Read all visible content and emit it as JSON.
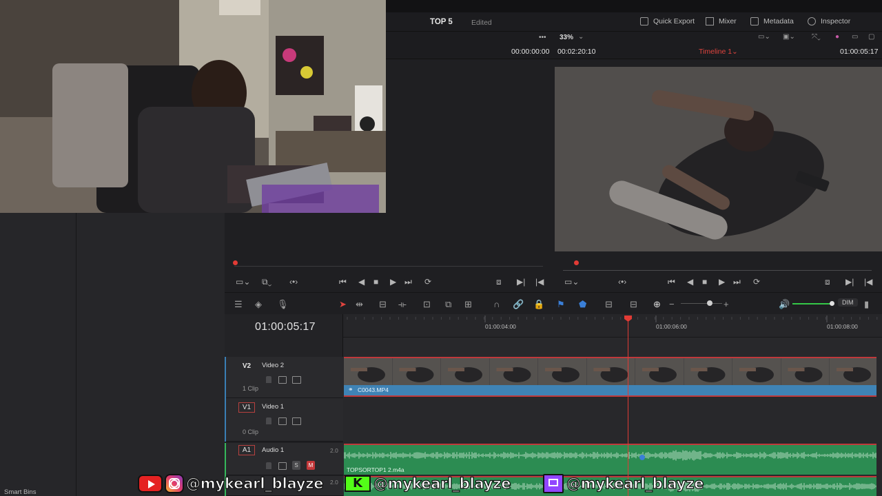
{
  "app": {
    "project_title": "TOP 5",
    "project_status": "Edited",
    "toolbar": {
      "quick_export": "Quick Export",
      "mixer": "Mixer",
      "metadata": "Metadata",
      "inspector": "Inspector"
    }
  },
  "viewer": {
    "zoom": "33%",
    "more": "•••",
    "source_tc_in": "00:00:00:00",
    "source_tc_dur": "00:02:20:10",
    "timeline_name": "Timeline 1",
    "program_tc": "01:00:05:17"
  },
  "timeline": {
    "current_tc": "01:00:05:17",
    "ruler_marks": [
      "01:00:04:00",
      "01:00:06:00",
      "01:00:08:00"
    ],
    "tracks": [
      {
        "id": "V2",
        "name": "Video 2",
        "count": "1 Clip"
      },
      {
        "id": "V1",
        "name": "Video 1",
        "count": "0 Clip"
      },
      {
        "id": "A1",
        "name": "Audio 1",
        "channels": "2.0",
        "solo": "S",
        "mute": "M"
      },
      {
        "channels": "2.0"
      }
    ],
    "clips": {
      "v2_clip": "C0043.MP4",
      "a1_clip": "TOPSORTOP1 2.m4a"
    },
    "dim_label": "DIM"
  },
  "sidebar": {
    "smart_bins": "Smart Bins"
  },
  "overlay": {
    "handle_1": "@mykearl_blayze",
    "handle_2": "@mykearl_blayze",
    "handle_3": "@mykearl_blayze",
    "kick_letter": "K"
  },
  "colors": {
    "accent_red": "#e23b35",
    "clip_blue": "#3f83b5",
    "audio_green": "#2c8c52",
    "volume_green": "#35c948"
  }
}
